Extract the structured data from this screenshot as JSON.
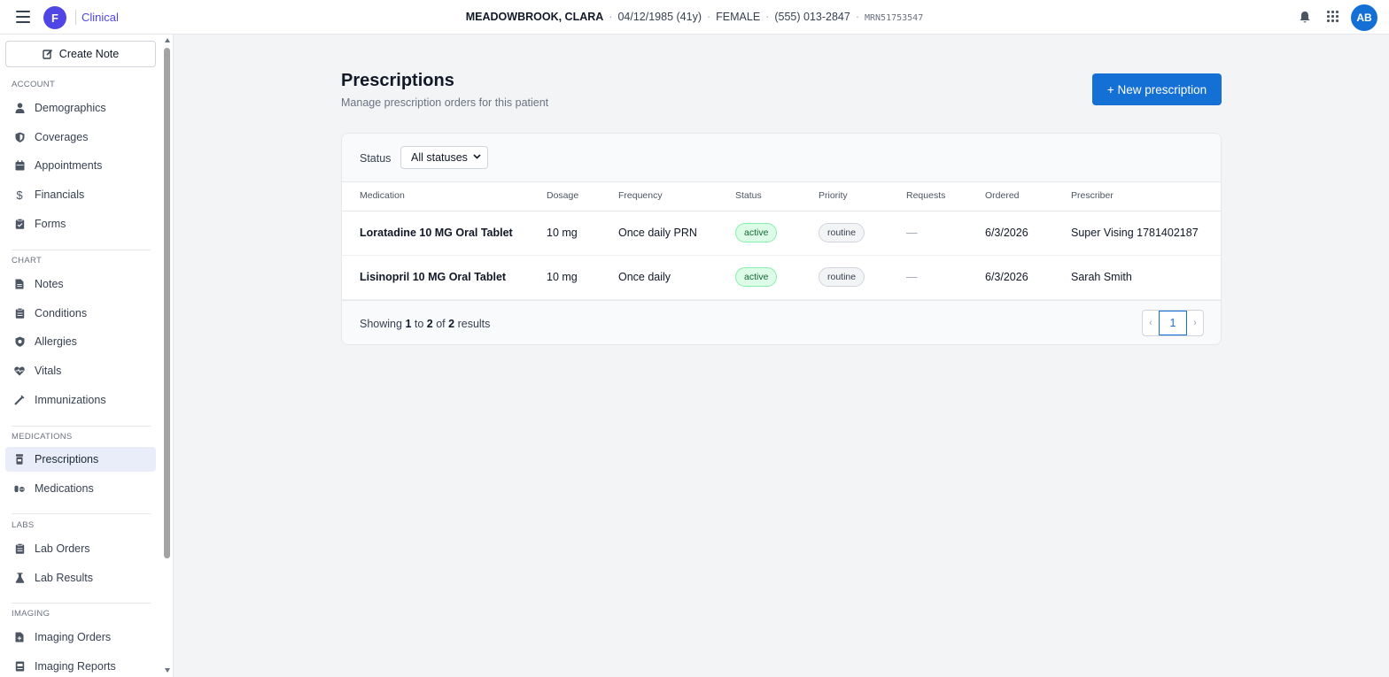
{
  "header": {
    "org_initial": "F",
    "app_name": "Clinical",
    "patient": {
      "name": "MEADOWBROOK, CLARA",
      "dob_age": "04/12/1985 (41y)",
      "sex": "FEMALE",
      "phone": "(555) 013-2847",
      "mrn": "MRN51753547"
    },
    "user_initials": "AB"
  },
  "sidebar": {
    "create_note": "Create Note",
    "sections": {
      "account": "ACCOUNT",
      "chart": "CHART",
      "medications": "MEDICATIONS",
      "labs": "LABS",
      "imaging": "IMAGING"
    },
    "items": {
      "demographics": "Demographics",
      "coverages": "Coverages",
      "appointments": "Appointments",
      "financials": "Financials",
      "forms": "Forms",
      "notes": "Notes",
      "conditions": "Conditions",
      "allergies": "Allergies",
      "vitals": "Vitals",
      "immunizations": "Immunizations",
      "prescriptions": "Prescriptions",
      "medications": "Medications",
      "lab_orders": "Lab Orders",
      "lab_results": "Lab Results",
      "imaging_orders": "Imaging Orders",
      "imaging_reports": "Imaging Reports"
    },
    "active_item": "prescriptions"
  },
  "main": {
    "title": "Prescriptions",
    "subtitle": "Manage prescription orders for this patient",
    "new_button": "+ New prescription",
    "filter": {
      "label": "Status",
      "selected": "All statuses"
    },
    "columns": {
      "medication": "Medication",
      "dosage": "Dosage",
      "frequency": "Frequency",
      "status": "Status",
      "priority": "Priority",
      "requests": "Requests",
      "ordered": "Ordered",
      "prescriber": "Prescriber"
    },
    "rows": [
      {
        "medication": "Loratadine 10 MG Oral Tablet",
        "dosage": "10 mg",
        "frequency": "Once daily PRN",
        "status": "active",
        "priority": "routine",
        "requests": "—",
        "ordered": "6/3/2026",
        "prescriber": "Super Vising 1781402187"
      },
      {
        "medication": "Lisinopril 10 MG Oral Tablet",
        "dosage": "10 mg",
        "frequency": "Once daily",
        "status": "active",
        "priority": "routine",
        "requests": "—",
        "ordered": "6/3/2026",
        "prescriber": "Sarah Smith"
      }
    ],
    "pagination": {
      "showing_prefix": "Showing",
      "from": "1",
      "to_word": "to",
      "to": "2",
      "of_word": "of",
      "total": "2",
      "results_word": "results",
      "current_page": "1",
      "prev_glyph": "‹",
      "next_glyph": "›"
    }
  },
  "colors": {
    "accent": "#1570d6",
    "brand": "#4f46e5",
    "active_badge_bg": "#dcfce7",
    "active_nav_bg": "#e8edf9"
  },
  "icons": {
    "menu": "hamburger-icon",
    "notifications": "bell-icon",
    "apps": "grid-icon",
    "create_note": "edit-icon"
  }
}
